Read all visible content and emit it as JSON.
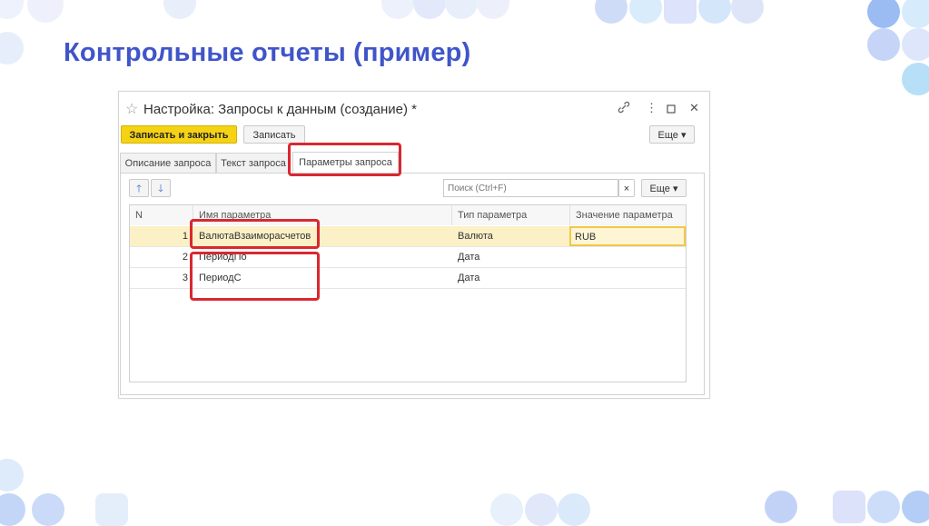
{
  "slide": {
    "title": "Контрольные отчеты (пример)"
  },
  "window": {
    "title": "Настройка: Запросы к данным (создание) *"
  },
  "toolbar": {
    "save_close_label": "Записать и закрыть",
    "save_label": "Записать",
    "more_label": "Еще"
  },
  "tabs": [
    {
      "label": "Описание запроса"
    },
    {
      "label": "Текст запроса"
    },
    {
      "label": "Параметры запроса"
    }
  ],
  "params_toolbar": {
    "search_placeholder": "Поиск (Ctrl+F)",
    "clear_label": "×",
    "more_label": "Еще"
  },
  "table": {
    "headers": {
      "n": "N",
      "name": "Имя параметра",
      "type": "Тип параметра",
      "value": "Значение параметра"
    },
    "rows": [
      {
        "n": "1",
        "name": "ВалютаВзаиморасчетов",
        "type": "Валюта",
        "value": "RUB"
      },
      {
        "n": "2",
        "name": "ПериодПо",
        "type": "Дата",
        "value": ""
      },
      {
        "n": "3",
        "name": "ПериодС",
        "type": "Дата",
        "value": ""
      }
    ]
  },
  "colors": {
    "accent": "#3f55c9",
    "highlight": "#d9282f",
    "primary_button": "#f5d214",
    "selected_row": "#fbf0c6"
  }
}
